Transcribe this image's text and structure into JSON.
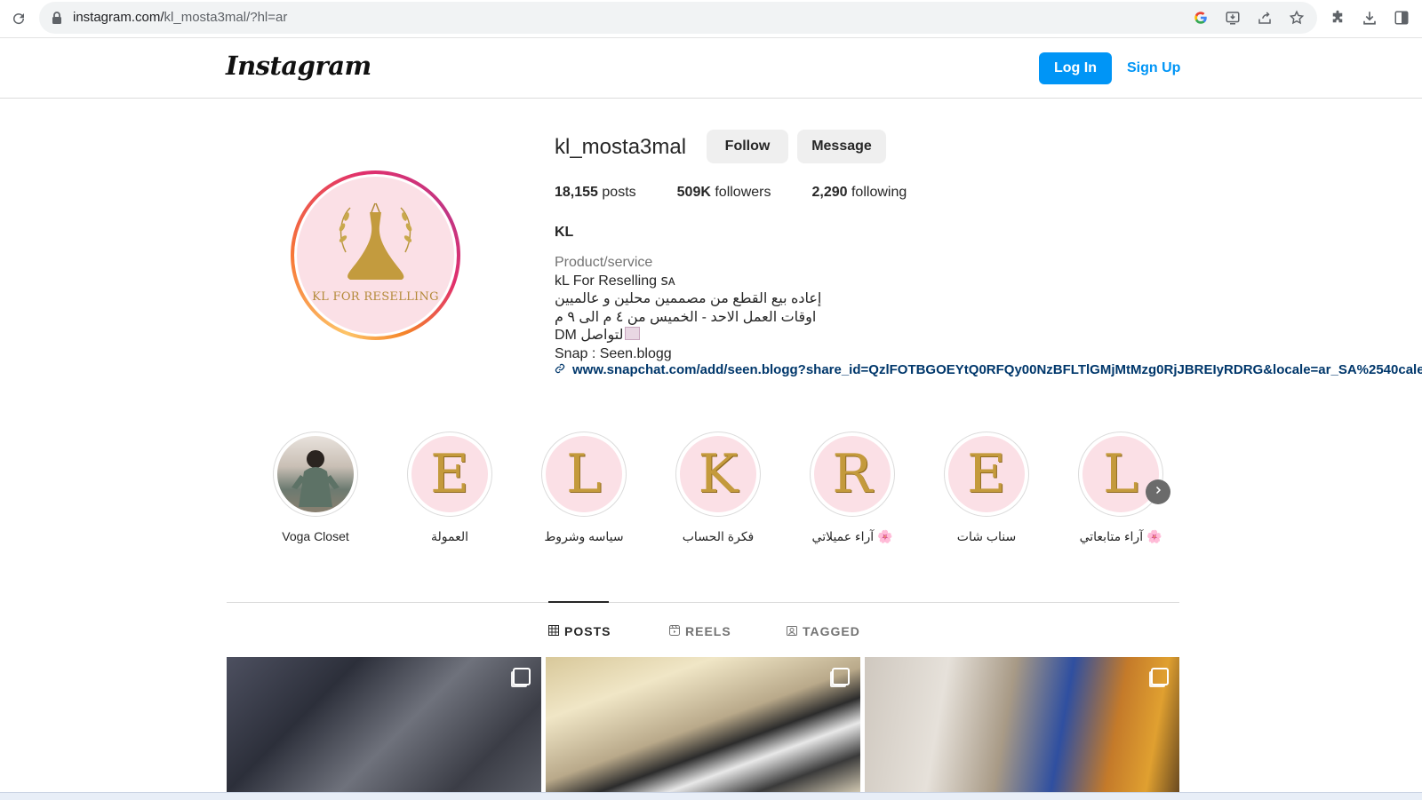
{
  "browser": {
    "url_host": "instagram.com/",
    "url_path": "kl_mosta3mal/?hl=ar",
    "icons": [
      "reload-icon",
      "lock-icon",
      "google-icon",
      "install-icon",
      "share-icon",
      "bookmark-star-icon",
      "extensions-icon",
      "download-icon",
      "sidepanel-icon"
    ]
  },
  "header": {
    "logo": "Instagram",
    "login_label": "Log In",
    "signup_label": "Sign Up",
    "accent": "#0095f6"
  },
  "profile": {
    "username": "kl_mosta3mal",
    "follow_label": "Follow",
    "message_label": "Message",
    "posts_count": "18,155",
    "posts_label": "posts",
    "followers_count": "509K",
    "followers_label": "followers",
    "following_count": "2,290",
    "following_label": "following",
    "full_name": "KL",
    "avatar_text": "KL FOR RESELLING",
    "category": "Product/service",
    "bio_line1": "kL For Reselling ꜱᴀ",
    "bio_line2": "إعاده بيع القطع من مصممين محلين و عالميين",
    "bio_line3": "اوقات العمل الاحد - الخميس من ٤ م الى ٩ م",
    "bio_line4": "لتواصل DM",
    "bio_line5": "Snap : Seen.blogg",
    "link": "www.snapchat.com/add/seen.blogg?share_id=QzlFOTBGOEYtQ0RFQy00NzBFLTlGMjMtMzg0RjJBREIyRDRG&locale=ar_SA%2540cale"
  },
  "highlights": [
    {
      "label": "Voga Closet",
      "letter": ""
    },
    {
      "label": "العمولة",
      "letter": "E"
    },
    {
      "label": "سياسه وشروط",
      "letter": "L"
    },
    {
      "label": "فكرة الحساب",
      "letter": "K"
    },
    {
      "label": "آراء عميلاتي 🌸",
      "letter": "R"
    },
    {
      "label": "سناب شات",
      "letter": "E"
    },
    {
      "label": "آراء متابعاتي 🌸",
      "letter": "L"
    }
  ],
  "tabs": {
    "posts": "POSTS",
    "reels": "REELS",
    "tagged": "TAGGED",
    "active": "posts"
  }
}
